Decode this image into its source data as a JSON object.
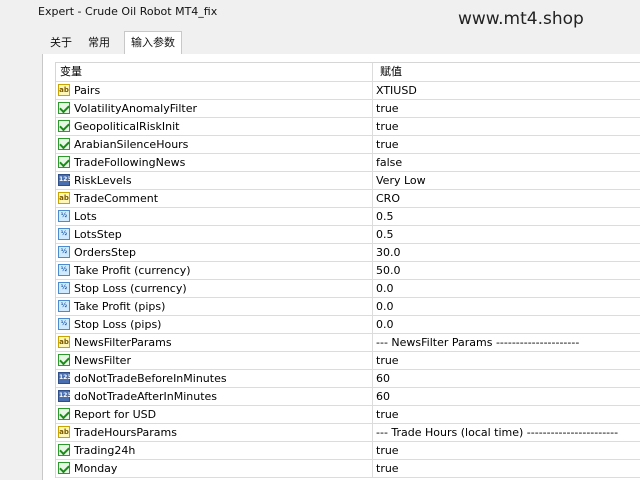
{
  "window": {
    "title": "Expert - Crude Oil Robot MT4_fix",
    "watermark": "www.mt4.shop"
  },
  "tabs": [
    {
      "label": "关于"
    },
    {
      "label": "常用"
    },
    {
      "label": "输入参数"
    }
  ],
  "table": {
    "headers": {
      "variable": "变量",
      "value": "赋值"
    },
    "rows": [
      {
        "icon": "ab",
        "name": "Pairs",
        "value": "XTIUSD"
      },
      {
        "icon": "bool",
        "name": "VolatilityAnomalyFilter",
        "value": "true"
      },
      {
        "icon": "bool",
        "name": "GeopoliticalRiskInit",
        "value": "true"
      },
      {
        "icon": "bool",
        "name": "ArabianSilenceHours",
        "value": "true"
      },
      {
        "icon": "bool",
        "name": "TradeFollowingNews",
        "value": "false"
      },
      {
        "icon": "num",
        "name": "RiskLevels",
        "value": "Very Low"
      },
      {
        "icon": "ab",
        "name": "TradeComment",
        "value": "CRO"
      },
      {
        "icon": "dbl",
        "name": "Lots",
        "value": "0.5"
      },
      {
        "icon": "dbl",
        "name": "LotsStep",
        "value": "0.5"
      },
      {
        "icon": "dbl",
        "name": "OrdersStep",
        "value": "30.0"
      },
      {
        "icon": "dbl",
        "name": "Take Profit (currency)",
        "value": "50.0"
      },
      {
        "icon": "dbl",
        "name": "Stop Loss (currency)",
        "value": "0.0"
      },
      {
        "icon": "dbl",
        "name": "Take Profit (pips)",
        "value": "0.0"
      },
      {
        "icon": "dbl",
        "name": "Stop Loss (pips)",
        "value": "0.0"
      },
      {
        "icon": "ab",
        "name": "NewsFilterParams",
        "value": "--- NewsFilter Params ---------------------"
      },
      {
        "icon": "bool",
        "name": "NewsFilter",
        "value": "true"
      },
      {
        "icon": "num",
        "name": "doNotTradeBeforeInMinutes",
        "value": "60"
      },
      {
        "icon": "num",
        "name": "doNotTradeAfterInMinutes",
        "value": "60"
      },
      {
        "icon": "bool",
        "name": "Report for USD",
        "value": "true"
      },
      {
        "icon": "ab",
        "name": "TradeHoursParams",
        "value": "--- Trade Hours  (local time) -----------------------"
      },
      {
        "icon": "bool",
        "name": "Trading24h",
        "value": "true"
      },
      {
        "icon": "bool",
        "name": "Monday",
        "value": "true"
      }
    ]
  }
}
